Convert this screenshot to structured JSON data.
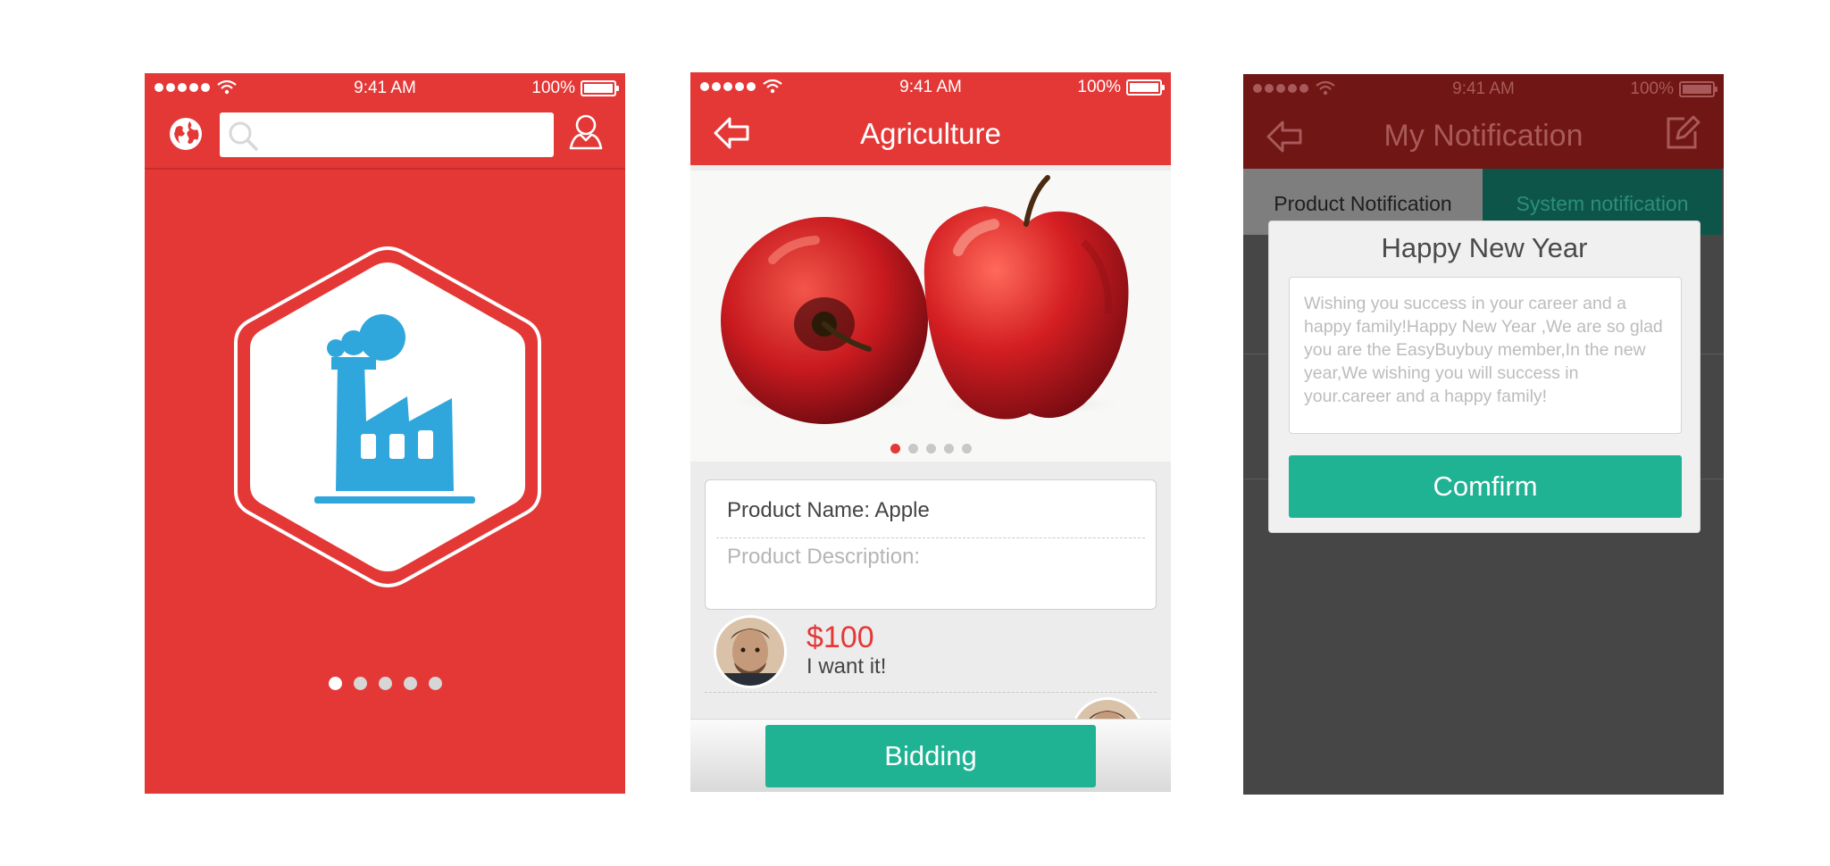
{
  "colors": {
    "brand_red": "#e43837",
    "accent_green": "#1fb293",
    "overlay_gray": "#464646",
    "factory_blue": "#2fa7dc"
  },
  "status_bar": {
    "time": "9:41 AM",
    "battery": "100%"
  },
  "screen1": {
    "icons": [
      "globe-icon",
      "search-icon",
      "user-icon",
      "factory-icon"
    ],
    "search_placeholder": "",
    "pager": {
      "count": 5,
      "active": 0
    }
  },
  "screen2": {
    "title": "Agriculture",
    "image_pager": {
      "count": 5,
      "active": 0
    },
    "product_name": "Product Name: Apple",
    "product_description": "Product Description:",
    "bid_price": "$100",
    "bid_message": "I want it!",
    "button_label": "Bidding"
  },
  "screen3": {
    "title": "My Notification",
    "tabs": [
      "Product Notification",
      "System notification"
    ],
    "dialog": {
      "title": "Happy New Year",
      "message": "Wishing you success in your career and a happy family!Happy New Year ,We are so glad you are the EasyBuybuy member,In the new year,We wishing you will success in your.career and a happy family!",
      "button_label": "Comfirm"
    }
  }
}
